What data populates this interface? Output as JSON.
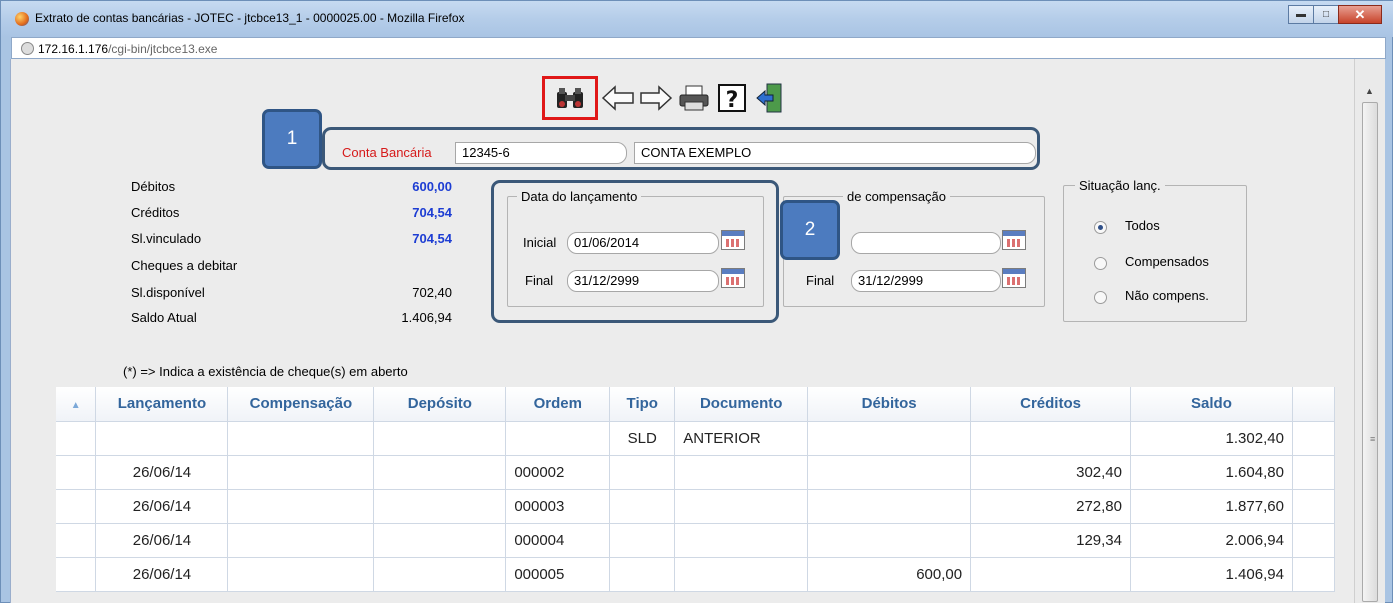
{
  "window": {
    "title": "Extrato de contas bancárias - JOTEC - jtcbce13_1 - 0000025.00 - Mozilla Firefox",
    "url_host": "172.16.1.176",
    "url_path": "/cgi-bin/jtcbce13.exe",
    "minimize_icon": "minimize-icon",
    "maximize_icon": "maximize-icon",
    "close_icon": "close-icon"
  },
  "toolbar": {
    "icons": [
      "binoculars-icon",
      "arrow-left-icon",
      "arrow-right-icon",
      "printer-icon",
      "help-icon",
      "exit-door-icon"
    ],
    "highlight_color": "#e01717"
  },
  "annotations": {
    "badge1": "1",
    "badge2": "2",
    "badge_color": "#4c7bbf"
  },
  "account": {
    "label": "Conta Bancária",
    "number": "12345-6",
    "name": "CONTA EXEMPLO"
  },
  "summary": {
    "debitos_label": "Débitos",
    "debitos_value": "600,00",
    "creditos_label": "Créditos",
    "creditos_value": "704,54",
    "vinculado_label": "Sl.vinculado",
    "vinculado_value": "704,54",
    "cheques_label": "Cheques a debitar",
    "disponivel_label": "Sl.disponível",
    "disponivel_value": "702,40",
    "saldo_label": "Saldo Atual",
    "saldo_value": "1.406,94"
  },
  "data_lancamento": {
    "legend": "Data do lançamento",
    "inicial_label": "Inicial",
    "inicial_value": "01/06/2014",
    "final_label": "Final",
    "final_value": "31/12/2999"
  },
  "data_compensacao": {
    "legend": "de compensação",
    "inicial_value": "",
    "final_label": "Final",
    "final_value": "31/12/2999"
  },
  "situacao": {
    "legend": "Situação lanç.",
    "options": [
      "Todos",
      "Compensados",
      "Não compens."
    ],
    "selected": "Todos"
  },
  "note": "(*) => Indica a existência de cheque(s) em aberto",
  "table": {
    "columns": [
      "Lançamento",
      "Compensação",
      "Depósito",
      "Ordem",
      "Tipo",
      "Documento",
      "Débitos",
      "Créditos",
      "Saldo"
    ],
    "rows": [
      {
        "lancamento": "",
        "compensacao": "",
        "deposito": "",
        "ordem": "",
        "tipo": "SLD",
        "documento": "ANTERIOR",
        "debitos": "",
        "creditos": "",
        "saldo": "1.302,40"
      },
      {
        "lancamento": "26/06/14",
        "compensacao": "",
        "deposito": "",
        "ordem": "000002",
        "tipo": "",
        "documento": "",
        "debitos": "",
        "creditos": "302,40",
        "saldo": "1.604,80"
      },
      {
        "lancamento": "26/06/14",
        "compensacao": "",
        "deposito": "",
        "ordem": "000003",
        "tipo": "",
        "documento": "",
        "debitos": "",
        "creditos": "272,80",
        "saldo": "1.877,60"
      },
      {
        "lancamento": "26/06/14",
        "compensacao": "",
        "deposito": "",
        "ordem": "000004",
        "tipo": "",
        "documento": "",
        "debitos": "",
        "creditos": "129,34",
        "saldo": "2.006,94"
      },
      {
        "lancamento": "26/06/14",
        "compensacao": "",
        "deposito": "",
        "ordem": "000005",
        "tipo": "",
        "documento": "",
        "debitos": "600,00",
        "creditos": "",
        "saldo": "1.406,94"
      }
    ]
  }
}
